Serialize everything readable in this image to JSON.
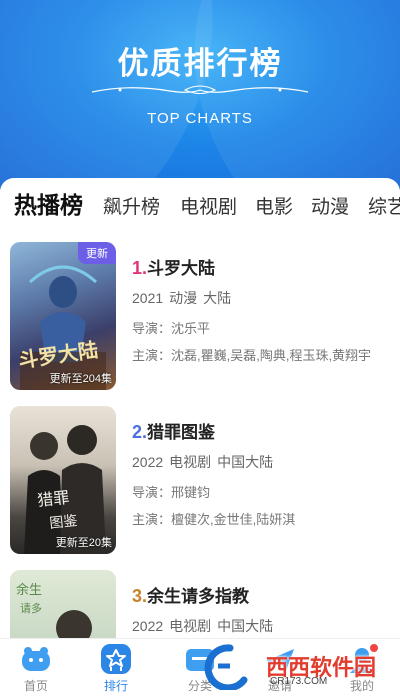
{
  "hero": {
    "title": "优质排行榜",
    "subtitle": "TOP CHARTS"
  },
  "tabs": [
    {
      "label": "热播榜",
      "active": true
    },
    {
      "label": "飙升榜",
      "active": false
    },
    {
      "label": "电视剧",
      "active": false
    },
    {
      "label": "电影",
      "active": false
    },
    {
      "label": "动漫",
      "active": false
    },
    {
      "label": "综艺",
      "active": false
    }
  ],
  "items": [
    {
      "rank": "1.",
      "rank_color": "#e0347a",
      "title": "斗罗大陆",
      "year": "2021",
      "genre": "动漫",
      "region": "大陆",
      "director": "导演：沈乐平",
      "cast": "主演：沈磊,瞿巍,吴磊,陶典,程玉珠,黄翔宇",
      "badge": "更新",
      "episodes": "更新至204集",
      "poster_text": "斗罗大陆"
    },
    {
      "rank": "2.",
      "rank_color": "#4a6fe0",
      "title": "猎罪图鉴",
      "year": "2022",
      "genre": "电视剧",
      "region": "中国大陆",
      "director": "导演：邢键钧",
      "cast": "主演：檀健次,金世佳,陆妍淇",
      "badge": "",
      "episodes": "更新至20集",
      "poster_text": "猎罪图鉴"
    },
    {
      "rank": "3.",
      "rank_color": "#c9832a",
      "title": "余生请多指教",
      "year": "2022",
      "genre": "电视剧",
      "region": "中国大陆",
      "director": "",
      "cast": "",
      "badge": "",
      "episodes": "",
      "poster_text": "余生请多指教"
    }
  ],
  "nav": [
    {
      "label": "首页",
      "icon": "home-icon",
      "active": false
    },
    {
      "label": "排行",
      "icon": "ranking-icon",
      "active": true
    },
    {
      "label": "分类",
      "icon": "category-icon",
      "active": false
    },
    {
      "label": "邀请",
      "icon": "invite-icon",
      "active": false
    },
    {
      "label": "我的",
      "icon": "profile-icon",
      "active": false
    }
  ],
  "watermark": {
    "text": "西西软件园",
    "domain": "CR173.COM"
  },
  "colors": {
    "accent": "#2b86e6",
    "hero_blue": "#1d86e8",
    "badge_purple": "#6d5ee8"
  }
}
